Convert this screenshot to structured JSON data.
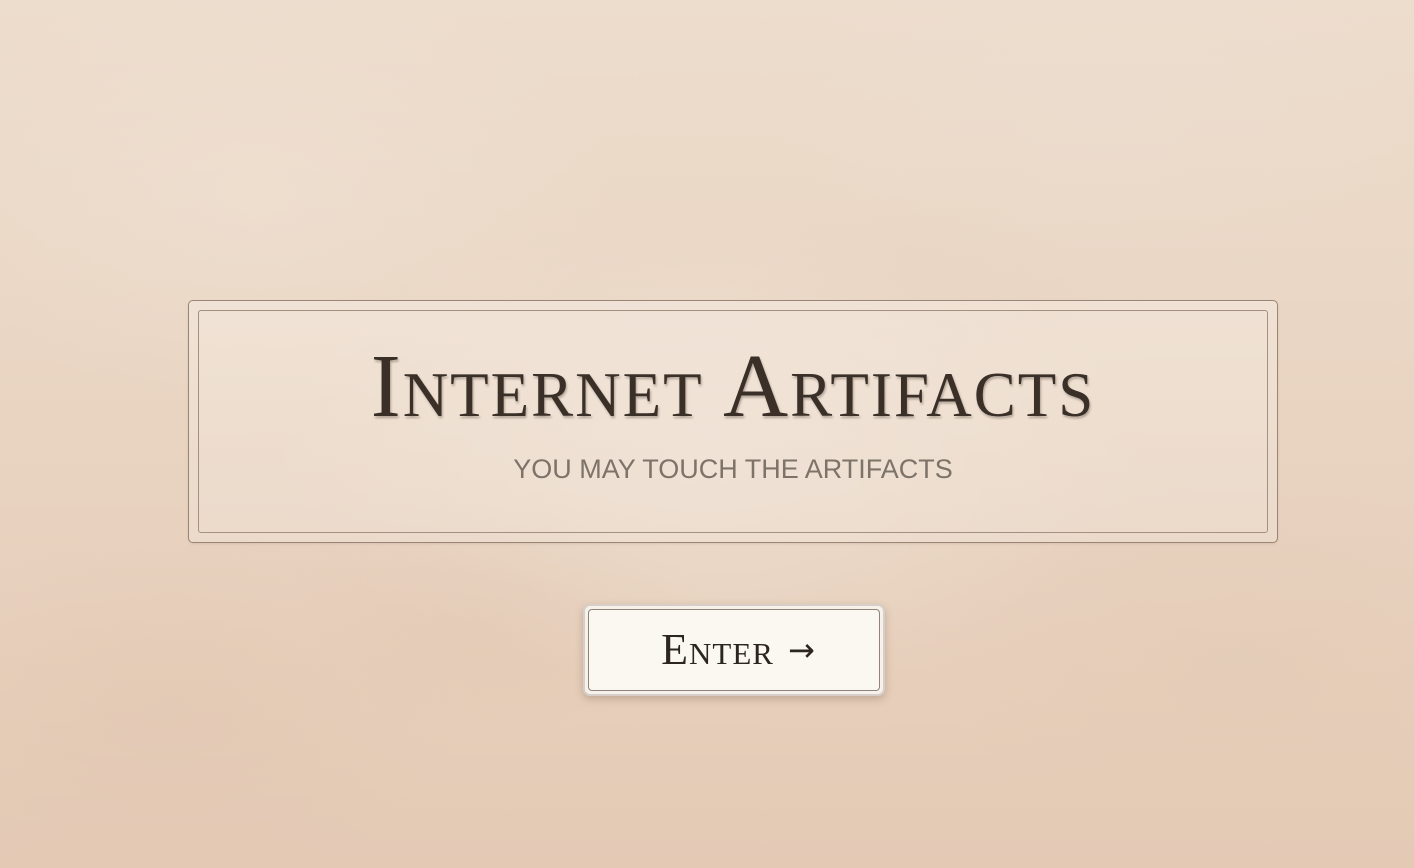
{
  "plaque": {
    "title": "Internet Artifacts",
    "subtitle": "YOU MAY TOUCH THE ARTIFACTS"
  },
  "enter_button": {
    "label": "Enter",
    "icon": "right-arrow-icon",
    "icon_glyph": "→"
  },
  "colors": {
    "background": "#ead6c4",
    "title_text": "#3a3028",
    "subtitle_text": "#7e7368",
    "border": "#9a8676",
    "button_fill": "#fbf7f1"
  }
}
